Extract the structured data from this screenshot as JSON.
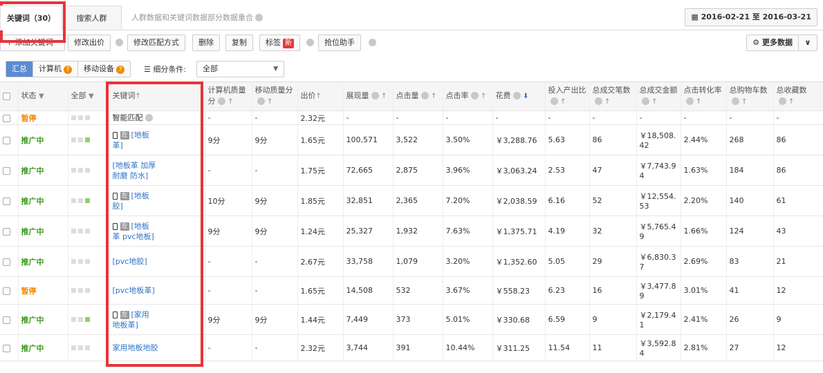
{
  "tabs": {
    "keywords": "关键词（30）",
    "crowd": "搜索人群",
    "note": "人群数据和关键词数据部分数据重合"
  },
  "date_range": "2016-02-21 至 2016-03-21",
  "toolbar": {
    "add_keyword": "添加关键词",
    "modify_bid": "修改出价",
    "modify_match": "修改匹配方式",
    "delete": "删除",
    "copy": "复制",
    "tag": "标签",
    "new_badge": "新",
    "rank_helper": "抢位助手",
    "more_data": "更多数据"
  },
  "filter": {
    "summary": "汇总",
    "computer": "计算机",
    "mobile": "移动设备",
    "condition_label": "细分条件:",
    "condition_value": "全部"
  },
  "columns": {
    "status": "状态",
    "all": "全部",
    "keyword": "关键词",
    "pc_quality_1": "计算机质量",
    "pc_quality_2": "分",
    "mob_quality_1": "移动质量分",
    "bid": "出价",
    "impressions": "展现量",
    "clicks": "点击量",
    "ctr": "点击率",
    "cost": "花费",
    "roi": "投入产出比",
    "orders": "总成交笔数",
    "gmv": "总成交金额",
    "cvr": "点击转化率",
    "cart": "总购物车数",
    "fav": "总收藏数"
  },
  "rows": [
    {
      "status": "暂停",
      "kind": "pause",
      "sq": [
        0,
        0,
        0
      ],
      "mobile_icon": false,
      "zuo": false,
      "keyword_l1": "智能匹配",
      "keyword_l2": "",
      "plain": true,
      "pcq": "-",
      "mq": "-",
      "bid": "2.32元",
      "imp": "-",
      "clk": "-",
      "ctr": "-",
      "cost": "-",
      "roi": "-",
      "orders": "-",
      "gmv_l1": "-",
      "gmv_l2": "",
      "cvr": "-",
      "cart": "-",
      "fav": "-"
    },
    {
      "status": "推广中",
      "kind": "on",
      "sq": [
        0,
        0,
        1
      ],
      "mobile_icon": true,
      "zuo": true,
      "keyword_l1": "[地板",
      "keyword_l2": "革]",
      "plain": false,
      "pcq": "9分",
      "mq": "9分",
      "bid": "1.65元",
      "imp": "100,571",
      "clk": "3,522",
      "ctr": "3.50%",
      "cost": "￥3,288.76",
      "roi": "5.63",
      "orders": "86",
      "gmv_l1": "￥18,508.",
      "gmv_l2": "42",
      "cvr": "2.44%",
      "cart": "268",
      "fav": "86"
    },
    {
      "status": "推广中",
      "kind": "on",
      "sq": [
        0,
        0,
        0
      ],
      "mobile_icon": false,
      "zuo": false,
      "keyword_l1": "[地板革 加厚",
      "keyword_l2": "耐磨 防水]",
      "plain": false,
      "pcq": "-",
      "mq": "-",
      "bid": "1.75元",
      "imp": "72,665",
      "clk": "2,875",
      "ctr": "3.96%",
      "cost": "￥3,063.24",
      "roi": "2.53",
      "orders": "47",
      "gmv_l1": "￥7,743.9",
      "gmv_l2": "4",
      "cvr": "1.63%",
      "cart": "184",
      "fav": "86"
    },
    {
      "status": "推广中",
      "kind": "on",
      "sq": [
        0,
        0,
        1
      ],
      "mobile_icon": true,
      "zuo": true,
      "keyword_l1": "[地板",
      "keyword_l2": "胶]",
      "plain": false,
      "pcq": "10分",
      "mq": "9分",
      "bid": "1.85元",
      "imp": "32,851",
      "clk": "2,365",
      "ctr": "7.20%",
      "cost": "￥2,038.59",
      "roi": "6.16",
      "orders": "52",
      "gmv_l1": "￥12,554.",
      "gmv_l2": "53",
      "cvr": "2.20%",
      "cart": "140",
      "fav": "61"
    },
    {
      "status": "推广中",
      "kind": "on",
      "sq": [
        0,
        0,
        0
      ],
      "mobile_icon": true,
      "zuo": true,
      "keyword_l1": "[地板",
      "keyword_l2": "革 pvc地板]",
      "plain": false,
      "pcq": "9分",
      "mq": "9分",
      "bid": "1.24元",
      "imp": "25,327",
      "clk": "1,932",
      "ctr": "7.63%",
      "cost": "￥1,375.71",
      "roi": "4.19",
      "orders": "32",
      "gmv_l1": "￥5,765.4",
      "gmv_l2": "9",
      "cvr": "1.66%",
      "cart": "124",
      "fav": "43"
    },
    {
      "status": "推广中",
      "kind": "on",
      "sq": [
        0,
        0,
        0
      ],
      "mobile_icon": false,
      "zuo": false,
      "keyword_l1": "[pvc地胶]",
      "keyword_l2": "",
      "plain": false,
      "pcq": "-",
      "mq": "-",
      "bid": "2.67元",
      "imp": "33,758",
      "clk": "1,079",
      "ctr": "3.20%",
      "cost": "￥1,352.60",
      "roi": "5.05",
      "orders": "29",
      "gmv_l1": "￥6,830.3",
      "gmv_l2": "7",
      "cvr": "2.69%",
      "cart": "83",
      "fav": "21"
    },
    {
      "status": "暂停",
      "kind": "pause",
      "sq": [
        0,
        0,
        0
      ],
      "mobile_icon": false,
      "zuo": false,
      "keyword_l1": "[pvc地板革]",
      "keyword_l2": "",
      "plain": false,
      "pcq": "-",
      "mq": "-",
      "bid": "1.65元",
      "imp": "14,508",
      "clk": "532",
      "ctr": "3.67%",
      "cost": "￥558.23",
      "roi": "6.23",
      "orders": "16",
      "gmv_l1": "￥3,477.8",
      "gmv_l2": "9",
      "cvr": "3.01%",
      "cart": "41",
      "fav": "12"
    },
    {
      "status": "推广中",
      "kind": "on",
      "sq": [
        0,
        0,
        1
      ],
      "mobile_icon": true,
      "zuo": true,
      "keyword_l1": "[家用",
      "keyword_l2": "地板革]",
      "plain": false,
      "pcq": "9分",
      "mq": "9分",
      "bid": "1.44元",
      "imp": "7,449",
      "clk": "373",
      "ctr": "5.01%",
      "cost": "￥330.68",
      "roi": "6.59",
      "orders": "9",
      "gmv_l1": "￥2,179.4",
      "gmv_l2": "1",
      "cvr": "2.41%",
      "cart": "26",
      "fav": "9"
    },
    {
      "status": "推广中",
      "kind": "on",
      "sq": [
        0,
        0,
        0
      ],
      "mobile_icon": false,
      "zuo": false,
      "keyword_l1": "家用地板地胶",
      "keyword_l2": "",
      "plain": false,
      "pcq": "-",
      "mq": "-",
      "bid": "2.32元",
      "imp": "3,744",
      "clk": "391",
      "ctr": "10.44%",
      "cost": "￥311.25",
      "roi": "11.54",
      "orders": "11",
      "gmv_l1": "￥3,592.8",
      "gmv_l2": "4",
      "cvr": "2.81%",
      "cart": "27",
      "fav": "12"
    }
  ],
  "zuo_label": "左",
  "colors": {
    "highlight": "#e8333a",
    "active": "#3c9a1e",
    "paused": "#f08a00",
    "link": "#2f73c6"
  }
}
